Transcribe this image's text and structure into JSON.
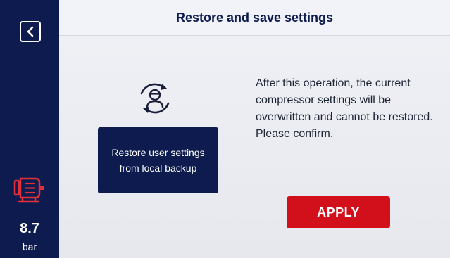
{
  "header": {
    "title": "Restore and save settings"
  },
  "sidebar": {
    "back_icon": "back-arrow-icon",
    "motor_icon": "compressor-motor-icon",
    "pressure_value": "8.7",
    "pressure_unit": "bar"
  },
  "main": {
    "restore_icon": "restore-user-icon",
    "restore_button_label": "Restore user settings from local backup",
    "info_text": "After this operation, the current compressor settings will be overwritten and cannot be restored. Please confirm.",
    "apply_label": "APPLY"
  },
  "colors": {
    "sidebar": "#0d1b4f",
    "header_bg": "#f1f3f8",
    "accent_red": "#d2101c",
    "button_navy": "#0d1b4f"
  }
}
